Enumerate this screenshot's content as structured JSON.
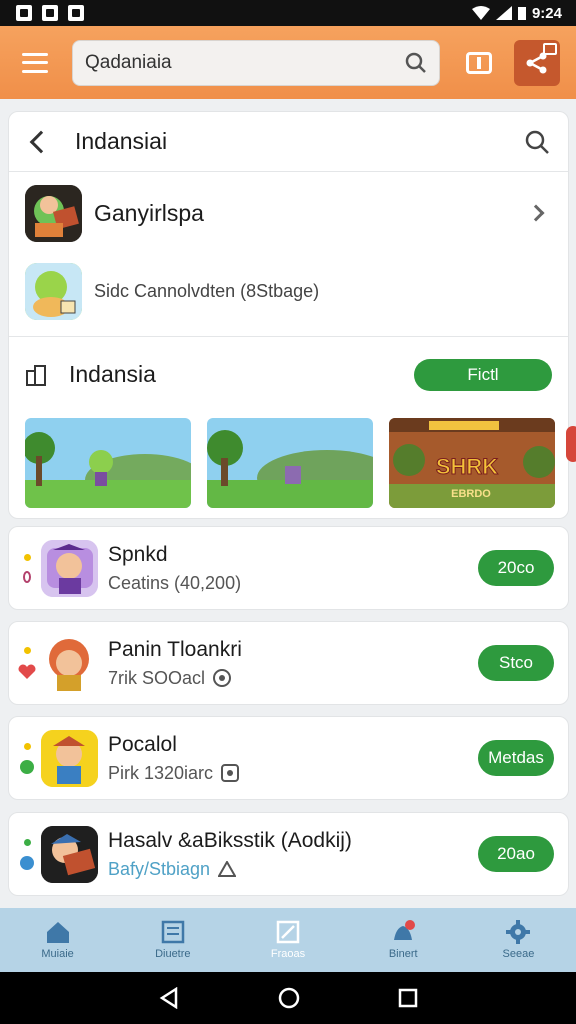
{
  "status_bar": {
    "time": "9:24"
  },
  "app_bar": {
    "search_value": "Qadaniaia"
  },
  "header": {
    "title": "Indansiai"
  },
  "featured": {
    "title": "Ganyirlspa",
    "subtitle": "Sidc Cannolvdten (8Stbage)"
  },
  "section": {
    "title": "Indansia",
    "button_label": "Fictl",
    "thumbnail_texts": [
      "SHRK",
      "EBRDO"
    ]
  },
  "list": [
    {
      "title": "Spnkd",
      "subtitle": "Ceatins (40,200)",
      "button": "20co"
    },
    {
      "title": "Panin Tloankri",
      "subtitle": "7rik SOOacl",
      "button": "Stco"
    },
    {
      "title": "Pocalol",
      "subtitle": "Pirk 1320iarc",
      "button": "Metdas"
    },
    {
      "title": "Hasalv &aBiksstik (Aodkij)",
      "subtitle": "Bafy/Stbiagn",
      "button": "20ao"
    }
  ],
  "bottom_nav": [
    {
      "label": "Muiaie",
      "icon": "home-icon"
    },
    {
      "label": "Diuetre",
      "icon": "book-icon"
    },
    {
      "label": "Fraoas",
      "icon": "edit-icon"
    },
    {
      "label": "Binert",
      "icon": "notification-icon"
    },
    {
      "label": "Seeae",
      "icon": "settings-icon"
    }
  ],
  "colors": {
    "accent": "#f29248",
    "green": "#2e9a3e",
    "nav": "#b5d3e6"
  }
}
